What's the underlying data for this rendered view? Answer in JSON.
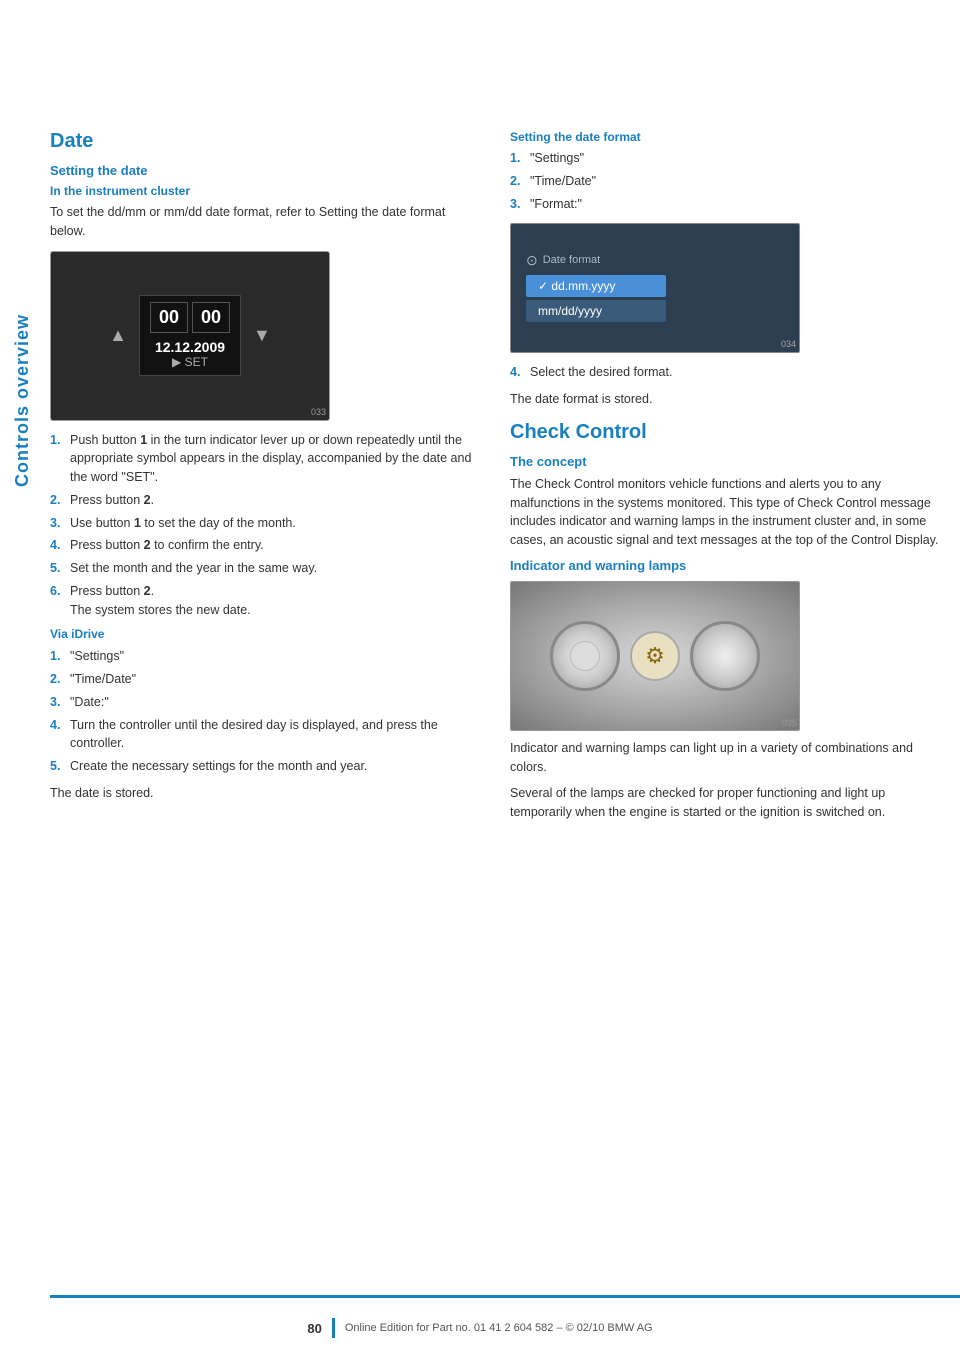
{
  "sidebar": {
    "label": "Controls overview"
  },
  "left_column": {
    "section_title": "Date",
    "setting_date_title": "Setting the date",
    "instrument_cluster_subtitle": "In the instrument cluster",
    "instrument_cluster_text": "To set the dd/mm or mm/dd date format, refer to Setting the date format below.",
    "instrument_steps": [
      {
        "num": "1.",
        "text": "Push button 1 in the turn indicator lever up or down repeatedly until the appropriate symbol appears in the display, accompanied by the date and the word \"SET\"."
      },
      {
        "num": "2.",
        "text": "Press button 2."
      },
      {
        "num": "3.",
        "text": "Use button 1 to set the day of the month."
      },
      {
        "num": "4.",
        "text": "Press button 2 to confirm the entry."
      },
      {
        "num": "5.",
        "text": "Set the month and the year in the same way."
      },
      {
        "num": "6.",
        "text": "Press button 2.\nThe system stores the new date."
      }
    ],
    "via_idrive_title": "Via iDrive",
    "via_idrive_steps": [
      {
        "num": "1.",
        "text": "\"Settings\""
      },
      {
        "num": "2.",
        "text": "\"Time/Date\""
      },
      {
        "num": "3.",
        "text": "\"Date:\""
      },
      {
        "num": "4.",
        "text": "Turn the controller until the desired day is displayed, and press the controller."
      },
      {
        "num": "5.",
        "text": "Create the necessary settings for the month and year."
      }
    ],
    "date_stored_text": "The date is stored.",
    "date_display_value": "12.12.2009",
    "date_display_set": "▶ SET",
    "image_caption_left": "033_G_US84_Date_Instr_cluster"
  },
  "right_column": {
    "setting_date_format_title": "Setting the date format",
    "format_steps": [
      {
        "num": "1.",
        "text": "\"Settings\""
      },
      {
        "num": "2.",
        "text": "\"Time/Date\""
      },
      {
        "num": "3.",
        "text": "\"Format:\""
      }
    ],
    "format_step4": "Select the desired format.",
    "format_stored_text": "The date format is stored.",
    "date_format_header": "Date format",
    "date_format_option1": "✓  dd.mm.yyyy",
    "date_format_option2": "   mm/dd/yyyy",
    "check_control_title": "Check Control",
    "concept_title": "The concept",
    "concept_text": "The Check Control monitors vehicle functions and alerts you to any malfunctions in the systems monitored. This type of Check Control message includes indicator and warning lamps in the instrument cluster and, in some cases, an acoustic signal and text messages at the top of the Control Display.",
    "indicator_title": "Indicator and warning lamps",
    "indicator_text1": "Indicator and warning lamps can light up in a variety of combinations and colors.",
    "indicator_text2": "Several of the lamps are checked for proper functioning and light up temporarily when the engine is started or the ignition is switched on."
  },
  "footer": {
    "page_number": "80",
    "footer_text": "Online Edition for Part no. 01 41 2 604 582 – © 02/10 BMW AG"
  }
}
